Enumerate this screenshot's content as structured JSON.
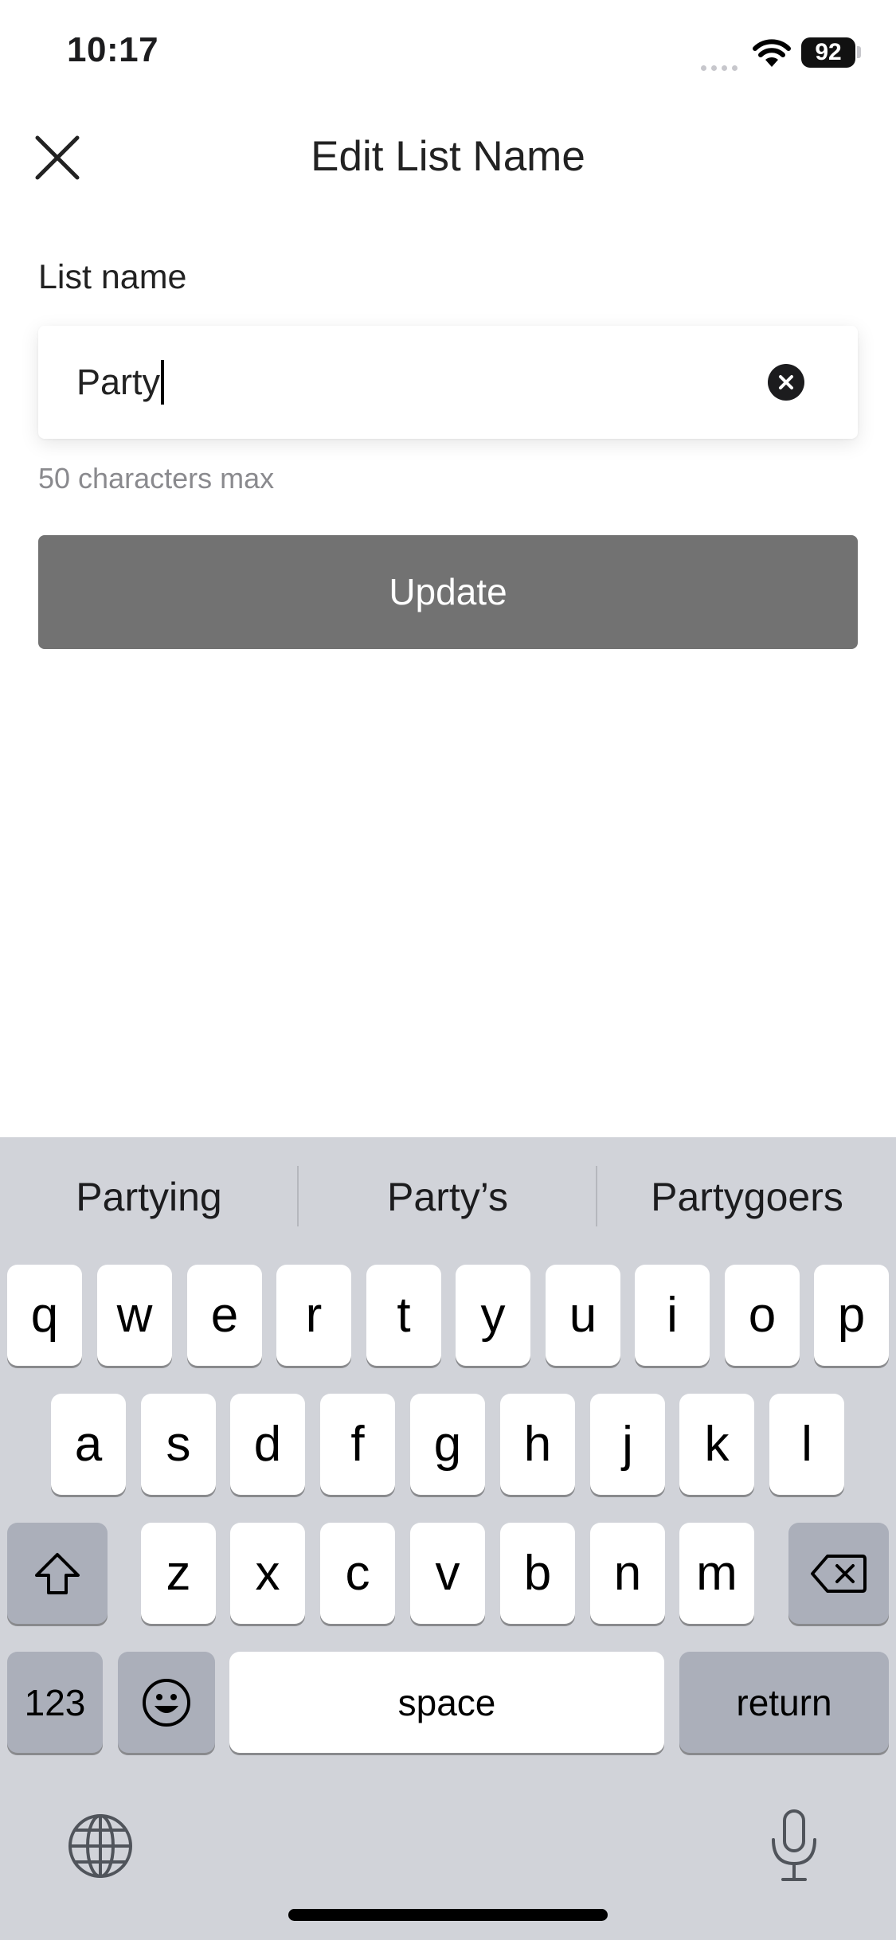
{
  "status_bar": {
    "time": "10:17",
    "battery": "92"
  },
  "header": {
    "title": "Edit List Name"
  },
  "form": {
    "label": "List name",
    "value": "Party",
    "helper": "50 characters max",
    "submit_label": "Update"
  },
  "keyboard": {
    "suggestions": [
      "Partying",
      "Party’s",
      "Partygoers"
    ],
    "row1": [
      "q",
      "w",
      "e",
      "r",
      "t",
      "y",
      "u",
      "i",
      "o",
      "p"
    ],
    "row2": [
      "a",
      "s",
      "d",
      "f",
      "g",
      "h",
      "j",
      "k",
      "l"
    ],
    "row3": [
      "z",
      "x",
      "c",
      "v",
      "b",
      "n",
      "m"
    ],
    "numbers_label": "123",
    "space_label": "space",
    "return_label": "return"
  },
  "icons": {
    "close": "close-icon",
    "clear": "clear-text-icon",
    "shift": "shift-icon",
    "delete": "backspace-icon",
    "emoji": "emoji-icon",
    "globe": "globe-icon",
    "microphone": "microphone-icon",
    "wifi": "wifi-icon"
  }
}
